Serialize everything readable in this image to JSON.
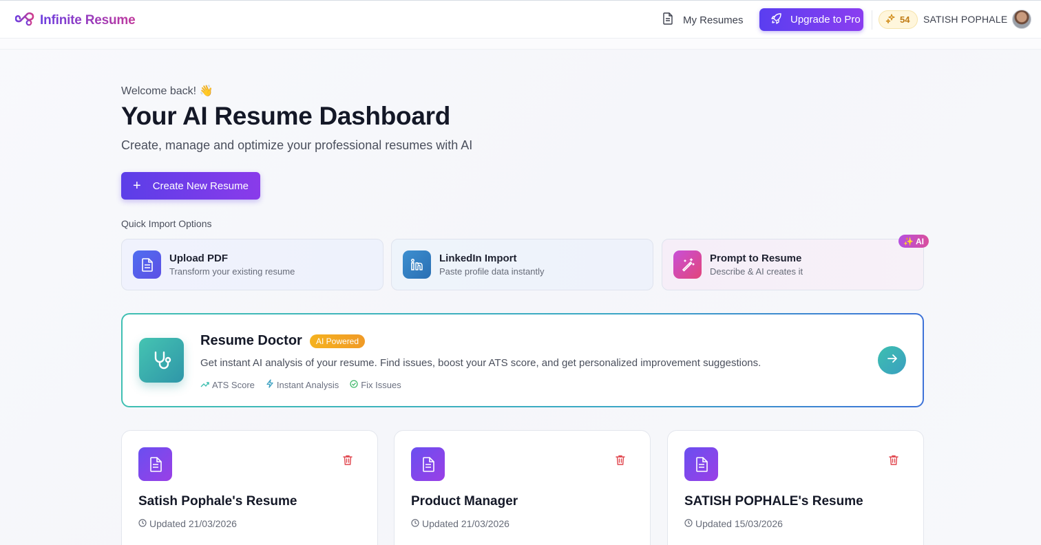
{
  "header": {
    "brand": "Infinite Resume",
    "nav_my_resumes": "My Resumes",
    "upgrade_label": "Upgrade to Pro",
    "credits": "54",
    "username": "SATISH POPHALE"
  },
  "hero": {
    "welcome": "Welcome back! 👋",
    "title": "Your AI Resume Dashboard",
    "subtitle": "Create, manage and optimize your professional resumes with AI",
    "create_label": "Create New Resume"
  },
  "quick_import": {
    "label": "Quick Import Options",
    "options": [
      {
        "title": "Upload PDF",
        "desc": "Transform your existing resume"
      },
      {
        "title": "LinkedIn Import",
        "desc": "Paste profile data instantly"
      },
      {
        "title": "Prompt to Resume",
        "desc": "Describe & AI creates it"
      }
    ],
    "ai_badge": "AI"
  },
  "doctor": {
    "title": "Resume Doctor",
    "badge": "AI Powered",
    "desc": "Get instant AI analysis of your resume. Find issues, boost your ATS score, and get personalized improvement suggestions.",
    "tags": [
      "ATS Score",
      "Instant Analysis",
      "Fix Issues"
    ]
  },
  "resumes": [
    {
      "title": "Satish Pophale's Resume",
      "updated": "Updated 21/03/2026"
    },
    {
      "title": "Product Manager",
      "updated": "Updated 21/03/2026"
    },
    {
      "title": "SATISH POPHALE's Resume",
      "updated": "Updated 15/03/2026"
    }
  ],
  "colors": {
    "accent": "#5b3ee8",
    "accent2": "#8a3bea",
    "teal": "#3dbfb0",
    "danger": "#e0454d",
    "credits_bg": "#fff6dc"
  },
  "icons": [
    "infinity-logo-icon",
    "document-icon",
    "rocket-icon",
    "sparkle-icon",
    "plus-icon",
    "file-icon",
    "linkedin-icon",
    "magic-wand-icon",
    "stethoscope-icon",
    "trend-up-icon",
    "zap-icon",
    "check-circle-icon",
    "arrow-right-icon",
    "trash-icon",
    "clock-icon"
  ]
}
